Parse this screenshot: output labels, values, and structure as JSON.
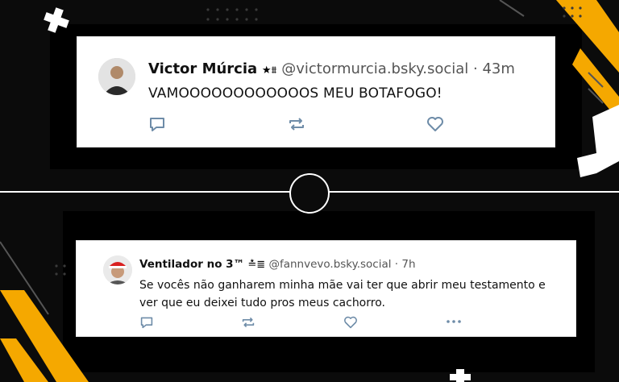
{
  "colors": {
    "background": "#0b0b0b",
    "accent_yellow": "#f5a800",
    "card": "#ffffff",
    "icon": "#6e8ca8"
  },
  "post1": {
    "name": "Victor Múrcia",
    "badge": "★⩩",
    "handle": "@victormurcia.bsky.social",
    "time": "· 43m",
    "text": "VAMOOOOOOOOOOOOS MEU BOTAFOGO!"
  },
  "post2": {
    "name": "Ventilador no 3™",
    "badge": "≛≣",
    "handle": "@fannvevo.bsky.social",
    "time": "· 7h",
    "text": "Se vocês não ganharem minha mãe vai ter que abrir meu testamento e ver que eu deixei tudo pros meus cachorro."
  },
  "icons": [
    "reply-icon",
    "repost-icon",
    "like-icon",
    "more-icon"
  ]
}
